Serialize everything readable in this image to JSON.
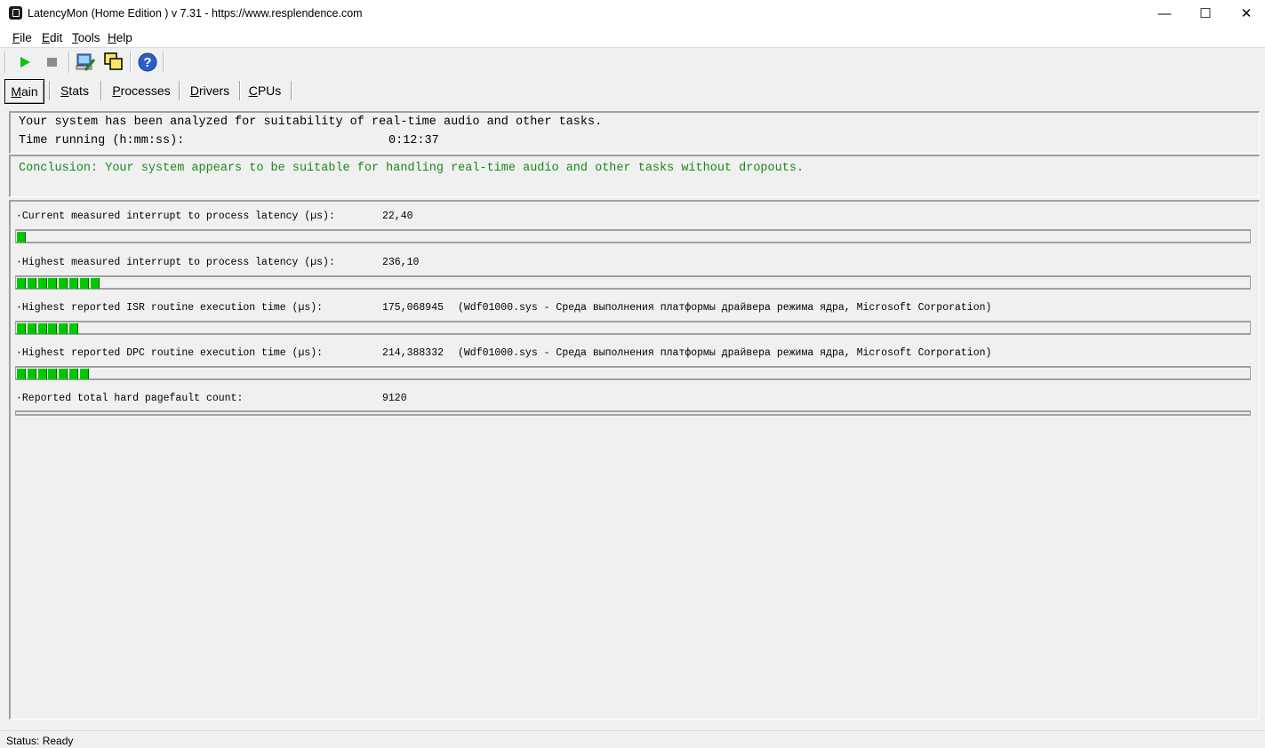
{
  "window": {
    "title": "LatencyMon  (Home Edition )  v 7.31 - https://www.resplendence.com",
    "minimize_glyph": "—",
    "maximize_glyph": "☐",
    "close_glyph": "✕"
  },
  "menu": {
    "items": [
      {
        "label": "File",
        "mnemonic": "F",
        "rest": "ile"
      },
      {
        "label": "Edit",
        "mnemonic": "E",
        "rest": "dit"
      },
      {
        "label": "Tools",
        "mnemonic": "T",
        "rest": "ools"
      },
      {
        "label": "Help",
        "mnemonic": "H",
        "rest": "elp"
      }
    ]
  },
  "toolbar": {
    "icons": [
      "play-icon",
      "stop-icon",
      "wizard-icon",
      "windows-icon",
      "help-icon"
    ]
  },
  "tabs": {
    "items": [
      {
        "label": "Main",
        "mnemonic": "M",
        "rest": "ain",
        "active": true
      },
      {
        "label": "Stats",
        "mnemonic": "S",
        "rest": "tats",
        "active": false
      },
      {
        "label": "Processes",
        "mnemonic": "P",
        "rest": "rocesses",
        "active": false
      },
      {
        "label": "Drivers",
        "mnemonic": "D",
        "rest": "rivers",
        "active": false
      },
      {
        "label": "CPUs",
        "mnemonic": "C",
        "rest": "PUs",
        "active": false
      }
    ]
  },
  "summary": {
    "line1": "Your system has been analyzed for suitability of real-time audio and other tasks.",
    "time_label": "Time running (h:mm:ss):",
    "time_value": "0:12:37"
  },
  "conclusion": {
    "text": "Conclusion: Your system appears to be suitable for handling real-time audio and other tasks without dropouts.",
    "color": "#1a8a1a"
  },
  "metrics": {
    "rows": [
      {
        "label": "·Current measured interrupt to process latency (µs):",
        "value": "22,40",
        "note": "",
        "segments": 1
      },
      {
        "label": "·Highest measured interrupt to process latency (µs):",
        "value": "236,10",
        "note": "",
        "segments": 8
      },
      {
        "label": "·Highest reported ISR routine execution time (µs):",
        "value": "175,068945",
        "note": "(Wdf01000.sys - Среда выполнения платформы драйвера режима ядра, Microsoft Corporation)",
        "segments": 6
      },
      {
        "label": "·Highest reported DPC routine execution time (µs):",
        "value": "214,388332",
        "note": "(Wdf01000.sys - Среда выполнения платформы драйвера режима ядра, Microsoft Corporation)",
        "segments": 7
      },
      {
        "label": "·Reported total hard pagefault count:",
        "value": "9120",
        "note": "",
        "segments": 0
      }
    ]
  },
  "status": {
    "text": "Status: Ready"
  }
}
